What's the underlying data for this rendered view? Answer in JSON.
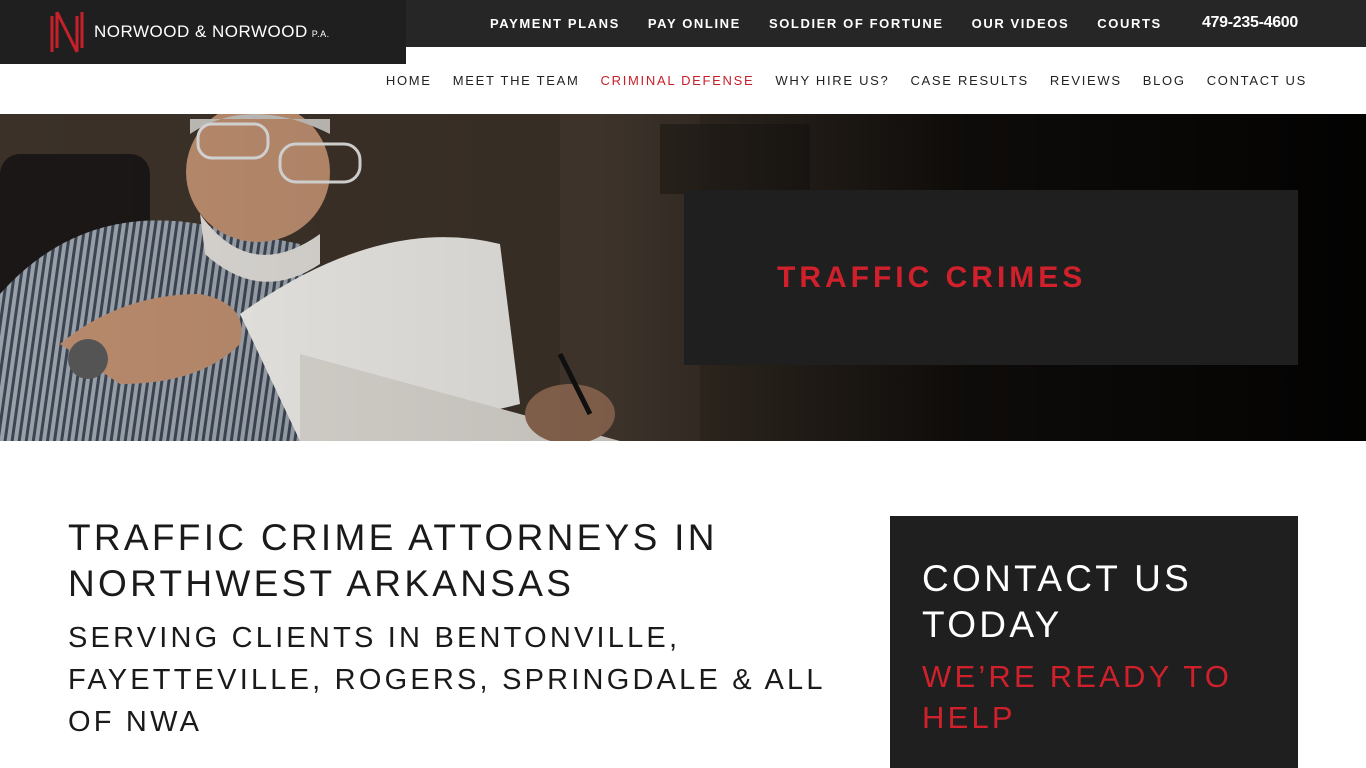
{
  "brand": {
    "name": "NORWOOD & NORWOOD",
    "suffix": "P.A."
  },
  "utility_nav": {
    "items": [
      "PAYMENT PLANS",
      "PAY ONLINE",
      "SOLDIER OF FORTUNE",
      "OUR VIDEOS",
      "COURTS"
    ],
    "phone": "479-235-4600"
  },
  "main_nav": {
    "items": [
      "HOME",
      "MEET THE TEAM",
      "CRIMINAL DEFENSE",
      "WHY HIRE US?",
      "CASE RESULTS",
      "REVIEWS",
      "BLOG",
      "CONTACT US"
    ],
    "active": "CRIMINAL DEFENSE"
  },
  "hero": {
    "title": "TRAFFIC CRIMES"
  },
  "content": {
    "heading": "TRAFFIC CRIME ATTORNEYS IN NORTHWEST ARKANSAS",
    "subheading": "SERVING CLIENTS IN BENTONVILLE, FAYETTEVILLE, ROGERS, SPRINGDALE & ALL OF NWA"
  },
  "sidebar": {
    "title": "CONTACT US TODAY",
    "subtitle": "WE’RE READY TO HELP"
  },
  "colors": {
    "accent_red": "#d0202b",
    "dark": "#1f1f1f",
    "topbar": "#262626"
  }
}
